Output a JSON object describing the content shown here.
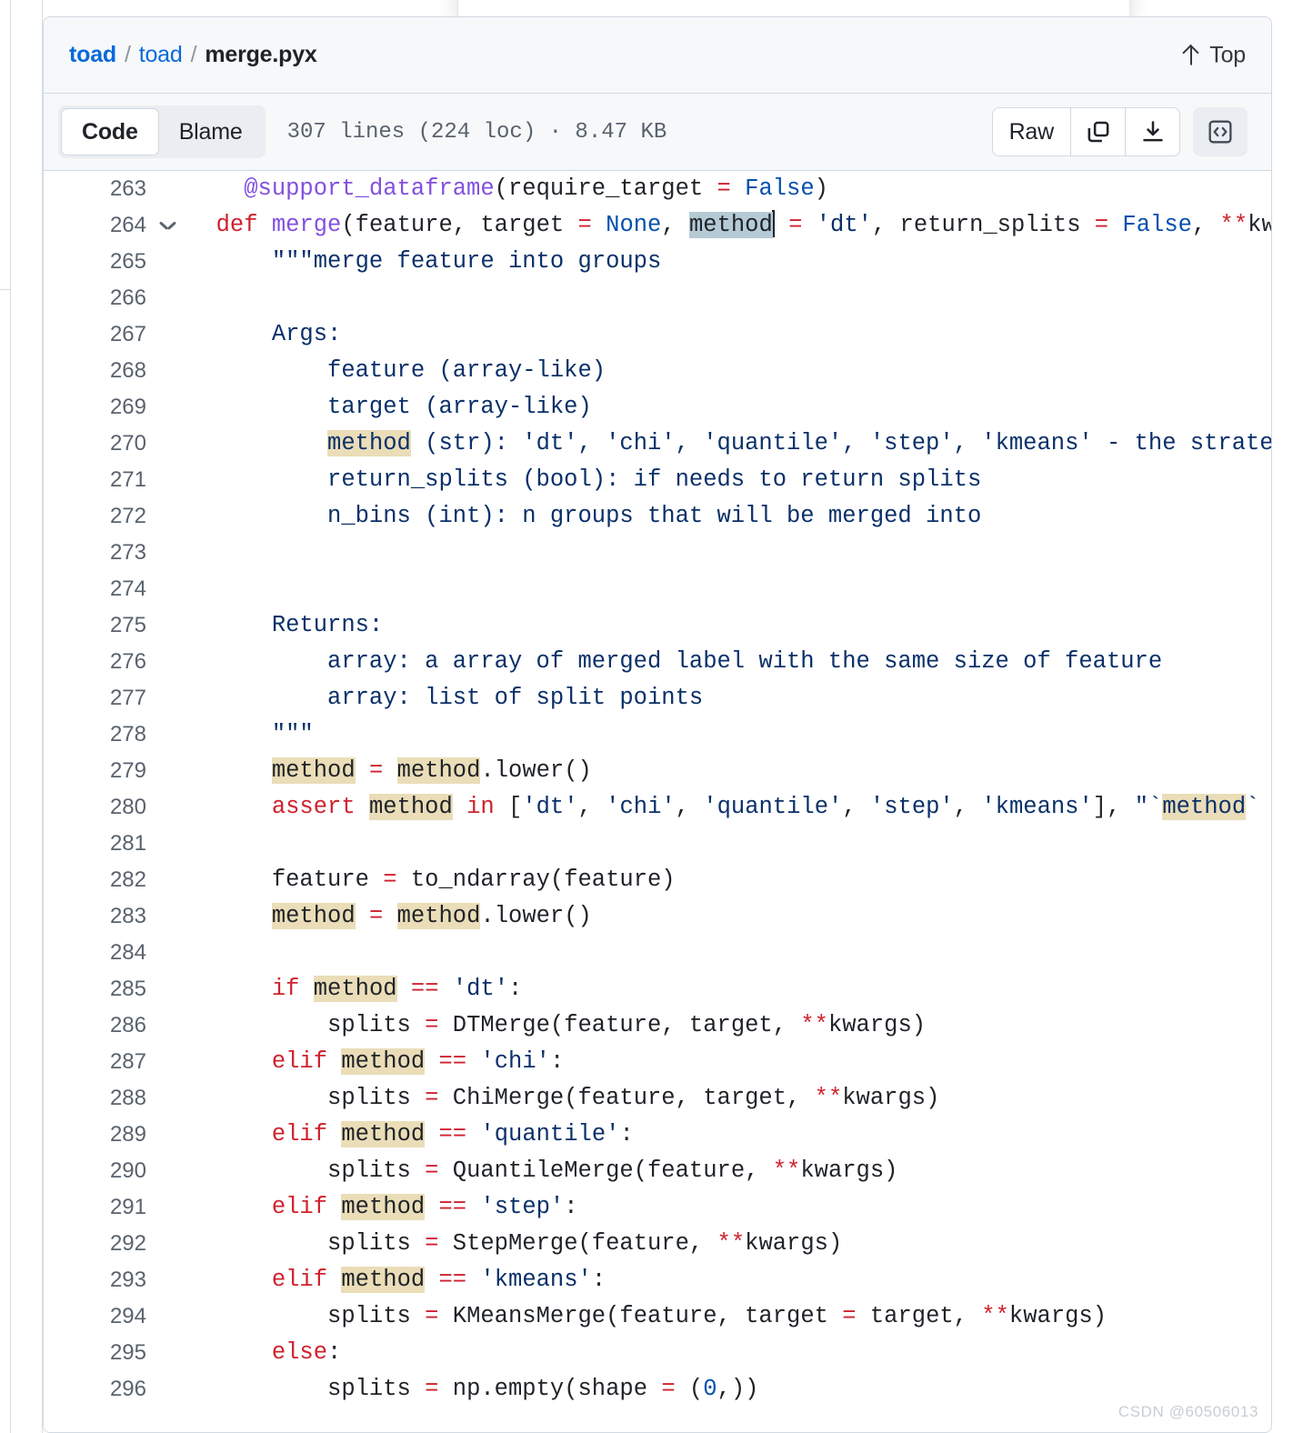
{
  "breadcrumb": {
    "owner": "toad",
    "repo": "toad",
    "separator": "/",
    "file": "merge.pyx"
  },
  "header": {
    "top_button_label": "Top"
  },
  "toolbar": {
    "tab_code": "Code",
    "tab_blame": "Blame",
    "file_meta": "307 lines (224 loc) · 8.47 KB",
    "raw_label": "Raw",
    "copy_icon": "copy-icon",
    "download_icon": "download-icon",
    "code_view_icon": "code-brackets-icon"
  },
  "watermark": "CSDN @60506013",
  "colors": {
    "link": "#0969da",
    "keyword": "#cf222e",
    "function": "#8250df",
    "constant": "#0550ae",
    "string": "#0a3069",
    "search_highlight": "#eaddb8",
    "selection_highlight": "#b6cad6",
    "header_bg": "#f6f8fa",
    "border": "#d1d9e0"
  },
  "code": {
    "first_line": 263,
    "last_line": 296,
    "lines": [
      {
        "n": 263,
        "fold": false,
        "tokens": [
          {
            "t": "    ",
            "c": "pln"
          },
          {
            "t": "@support_dataframe",
            "c": "fn"
          },
          {
            "t": "(require_target ",
            "c": "pln"
          },
          {
            "t": "=",
            "c": "op"
          },
          {
            "t": " ",
            "c": "pln"
          },
          {
            "t": "False",
            "c": "cst"
          },
          {
            "t": ")",
            "c": "pln"
          }
        ]
      },
      {
        "n": 264,
        "fold": true,
        "tokens": [
          {
            "t": "  ",
            "c": "pln"
          },
          {
            "t": "def",
            "c": "k"
          },
          {
            "t": " ",
            "c": "pln"
          },
          {
            "t": "merge",
            "c": "fn"
          },
          {
            "t": "(feature, target ",
            "c": "pln"
          },
          {
            "t": "=",
            "c": "op"
          },
          {
            "t": " ",
            "c": "pln"
          },
          {
            "t": "None",
            "c": "cst"
          },
          {
            "t": ", ",
            "c": "pln"
          },
          {
            "t": "method",
            "c": "pln",
            "h": "sel",
            "caret": true
          },
          {
            "t": " ",
            "c": "pln"
          },
          {
            "t": "=",
            "c": "op"
          },
          {
            "t": " ",
            "c": "pln"
          },
          {
            "t": "'dt'",
            "c": "str"
          },
          {
            "t": ", return_splits ",
            "c": "pln"
          },
          {
            "t": "=",
            "c": "op"
          },
          {
            "t": " ",
            "c": "pln"
          },
          {
            "t": "False",
            "c": "cst"
          },
          {
            "t": ", ",
            "c": "pln"
          },
          {
            "t": "**",
            "c": "op"
          },
          {
            "t": "kwargs)",
            "c": "pln"
          }
        ]
      },
      {
        "n": 265,
        "fold": false,
        "tokens": [
          {
            "t": "      \"\"\"merge feature into groups",
            "c": "str"
          }
        ]
      },
      {
        "n": 266,
        "fold": false,
        "tokens": []
      },
      {
        "n": 267,
        "fold": false,
        "tokens": [
          {
            "t": "      Args:",
            "c": "str"
          }
        ]
      },
      {
        "n": 268,
        "fold": false,
        "tokens": [
          {
            "t": "          feature (array-like)",
            "c": "str"
          }
        ]
      },
      {
        "n": 269,
        "fold": false,
        "tokens": [
          {
            "t": "          target (array-like)",
            "c": "str"
          }
        ]
      },
      {
        "n": 270,
        "fold": false,
        "tokens": [
          {
            "t": "          ",
            "c": "str"
          },
          {
            "t": "method",
            "c": "str",
            "h": "hl"
          },
          {
            "t": " (str): 'dt', 'chi', 'quantile', 'step', 'kmeans' - the strategy to",
            "c": "str"
          }
        ]
      },
      {
        "n": 271,
        "fold": false,
        "tokens": [
          {
            "t": "          return_splits (bool): if needs to return splits",
            "c": "str"
          }
        ]
      },
      {
        "n": 272,
        "fold": false,
        "tokens": [
          {
            "t": "          n_bins (int): n groups that will be merged into",
            "c": "str"
          }
        ]
      },
      {
        "n": 273,
        "fold": false,
        "tokens": []
      },
      {
        "n": 274,
        "fold": false,
        "tokens": []
      },
      {
        "n": 275,
        "fold": false,
        "tokens": [
          {
            "t": "      Returns:",
            "c": "str"
          }
        ]
      },
      {
        "n": 276,
        "fold": false,
        "tokens": [
          {
            "t": "          array: a array of merged label with the same size of feature",
            "c": "str"
          }
        ]
      },
      {
        "n": 277,
        "fold": false,
        "tokens": [
          {
            "t": "          array: list of split points",
            "c": "str"
          }
        ]
      },
      {
        "n": 278,
        "fold": false,
        "tokens": [
          {
            "t": "      \"\"\"",
            "c": "str"
          }
        ]
      },
      {
        "n": 279,
        "fold": false,
        "tokens": [
          {
            "t": "      ",
            "c": "pln"
          },
          {
            "t": "method",
            "c": "pln",
            "h": "hl"
          },
          {
            "t": " ",
            "c": "pln"
          },
          {
            "t": "=",
            "c": "op"
          },
          {
            "t": " ",
            "c": "pln"
          },
          {
            "t": "method",
            "c": "pln",
            "h": "hl"
          },
          {
            "t": ".lower()",
            "c": "pln"
          }
        ]
      },
      {
        "n": 280,
        "fold": false,
        "tokens": [
          {
            "t": "      ",
            "c": "pln"
          },
          {
            "t": "assert",
            "c": "k"
          },
          {
            "t": " ",
            "c": "pln"
          },
          {
            "t": "method",
            "c": "pln",
            "h": "hl"
          },
          {
            "t": " ",
            "c": "pln"
          },
          {
            "t": "in",
            "c": "k"
          },
          {
            "t": " [",
            "c": "pln"
          },
          {
            "t": "'dt'",
            "c": "str"
          },
          {
            "t": ", ",
            "c": "pln"
          },
          {
            "t": "'chi'",
            "c": "str"
          },
          {
            "t": ", ",
            "c": "pln"
          },
          {
            "t": "'quantile'",
            "c": "str"
          },
          {
            "t": ", ",
            "c": "pln"
          },
          {
            "t": "'step'",
            "c": "str"
          },
          {
            "t": ", ",
            "c": "pln"
          },
          {
            "t": "'kmeans'",
            "c": "str"
          },
          {
            "t": "], ",
            "c": "pln"
          },
          {
            "t": "\"`",
            "c": "str"
          },
          {
            "t": "method",
            "c": "str",
            "h": "hl"
          },
          {
            "t": "` must ",
            "c": "str"
          }
        ]
      },
      {
        "n": 281,
        "fold": false,
        "tokens": []
      },
      {
        "n": 282,
        "fold": false,
        "tokens": [
          {
            "t": "      feature ",
            "c": "pln"
          },
          {
            "t": "=",
            "c": "op"
          },
          {
            "t": " to_ndarray(feature)",
            "c": "pln"
          }
        ]
      },
      {
        "n": 283,
        "fold": false,
        "tokens": [
          {
            "t": "      ",
            "c": "pln"
          },
          {
            "t": "method",
            "c": "pln",
            "h": "hl"
          },
          {
            "t": " ",
            "c": "pln"
          },
          {
            "t": "=",
            "c": "op"
          },
          {
            "t": " ",
            "c": "pln"
          },
          {
            "t": "method",
            "c": "pln",
            "h": "hl"
          },
          {
            "t": ".lower()",
            "c": "pln"
          }
        ]
      },
      {
        "n": 284,
        "fold": false,
        "tokens": []
      },
      {
        "n": 285,
        "fold": false,
        "tokens": [
          {
            "t": "      ",
            "c": "pln"
          },
          {
            "t": "if",
            "c": "k"
          },
          {
            "t": " ",
            "c": "pln"
          },
          {
            "t": "method",
            "c": "pln",
            "h": "hl"
          },
          {
            "t": " ",
            "c": "pln"
          },
          {
            "t": "==",
            "c": "op"
          },
          {
            "t": " ",
            "c": "pln"
          },
          {
            "t": "'dt'",
            "c": "str"
          },
          {
            "t": ":",
            "c": "pln"
          }
        ]
      },
      {
        "n": 286,
        "fold": false,
        "tokens": [
          {
            "t": "          splits ",
            "c": "pln"
          },
          {
            "t": "=",
            "c": "op"
          },
          {
            "t": " DTMerge(feature, target, ",
            "c": "pln"
          },
          {
            "t": "**",
            "c": "op"
          },
          {
            "t": "kwargs)",
            "c": "pln"
          }
        ]
      },
      {
        "n": 287,
        "fold": false,
        "tokens": [
          {
            "t": "      ",
            "c": "pln"
          },
          {
            "t": "elif",
            "c": "k"
          },
          {
            "t": " ",
            "c": "pln"
          },
          {
            "t": "method",
            "c": "pln",
            "h": "hl"
          },
          {
            "t": " ",
            "c": "pln"
          },
          {
            "t": "==",
            "c": "op"
          },
          {
            "t": " ",
            "c": "pln"
          },
          {
            "t": "'chi'",
            "c": "str"
          },
          {
            "t": ":",
            "c": "pln"
          }
        ]
      },
      {
        "n": 288,
        "fold": false,
        "tokens": [
          {
            "t": "          splits ",
            "c": "pln"
          },
          {
            "t": "=",
            "c": "op"
          },
          {
            "t": " ChiMerge(feature, target, ",
            "c": "pln"
          },
          {
            "t": "**",
            "c": "op"
          },
          {
            "t": "kwargs)",
            "c": "pln"
          }
        ]
      },
      {
        "n": 289,
        "fold": false,
        "tokens": [
          {
            "t": "      ",
            "c": "pln"
          },
          {
            "t": "elif",
            "c": "k"
          },
          {
            "t": " ",
            "c": "pln"
          },
          {
            "t": "method",
            "c": "pln",
            "h": "hl"
          },
          {
            "t": " ",
            "c": "pln"
          },
          {
            "t": "==",
            "c": "op"
          },
          {
            "t": " ",
            "c": "pln"
          },
          {
            "t": "'quantile'",
            "c": "str"
          },
          {
            "t": ":",
            "c": "pln"
          }
        ]
      },
      {
        "n": 290,
        "fold": false,
        "tokens": [
          {
            "t": "          splits ",
            "c": "pln"
          },
          {
            "t": "=",
            "c": "op"
          },
          {
            "t": " QuantileMerge(feature, ",
            "c": "pln"
          },
          {
            "t": "**",
            "c": "op"
          },
          {
            "t": "kwargs)",
            "c": "pln"
          }
        ]
      },
      {
        "n": 291,
        "fold": false,
        "tokens": [
          {
            "t": "      ",
            "c": "pln"
          },
          {
            "t": "elif",
            "c": "k"
          },
          {
            "t": " ",
            "c": "pln"
          },
          {
            "t": "method",
            "c": "pln",
            "h": "hl"
          },
          {
            "t": " ",
            "c": "pln"
          },
          {
            "t": "==",
            "c": "op"
          },
          {
            "t": " ",
            "c": "pln"
          },
          {
            "t": "'step'",
            "c": "str"
          },
          {
            "t": ":",
            "c": "pln"
          }
        ]
      },
      {
        "n": 292,
        "fold": false,
        "tokens": [
          {
            "t": "          splits ",
            "c": "pln"
          },
          {
            "t": "=",
            "c": "op"
          },
          {
            "t": " StepMerge(feature, ",
            "c": "pln"
          },
          {
            "t": "**",
            "c": "op"
          },
          {
            "t": "kwargs)",
            "c": "pln"
          }
        ]
      },
      {
        "n": 293,
        "fold": false,
        "tokens": [
          {
            "t": "      ",
            "c": "pln"
          },
          {
            "t": "elif",
            "c": "k"
          },
          {
            "t": " ",
            "c": "pln"
          },
          {
            "t": "method",
            "c": "pln",
            "h": "hl"
          },
          {
            "t": " ",
            "c": "pln"
          },
          {
            "t": "==",
            "c": "op"
          },
          {
            "t": " ",
            "c": "pln"
          },
          {
            "t": "'kmeans'",
            "c": "str"
          },
          {
            "t": ":",
            "c": "pln"
          }
        ]
      },
      {
        "n": 294,
        "fold": false,
        "tokens": [
          {
            "t": "          splits ",
            "c": "pln"
          },
          {
            "t": "=",
            "c": "op"
          },
          {
            "t": " KMeansMerge(feature, target ",
            "c": "pln"
          },
          {
            "t": "=",
            "c": "op"
          },
          {
            "t": " target, ",
            "c": "pln"
          },
          {
            "t": "**",
            "c": "op"
          },
          {
            "t": "kwargs)",
            "c": "pln"
          }
        ]
      },
      {
        "n": 295,
        "fold": false,
        "tokens": [
          {
            "t": "      ",
            "c": "pln"
          },
          {
            "t": "else",
            "c": "k"
          },
          {
            "t": ":",
            "c": "pln"
          }
        ]
      },
      {
        "n": 296,
        "fold": false,
        "tokens": [
          {
            "t": "          splits ",
            "c": "pln"
          },
          {
            "t": "=",
            "c": "op"
          },
          {
            "t": " np.empty(shape ",
            "c": "pln"
          },
          {
            "t": "=",
            "c": "op"
          },
          {
            "t": " (",
            "c": "pln"
          },
          {
            "t": "0",
            "c": "cst"
          },
          {
            "t": ",))",
            "c": "pln"
          }
        ]
      }
    ]
  }
}
